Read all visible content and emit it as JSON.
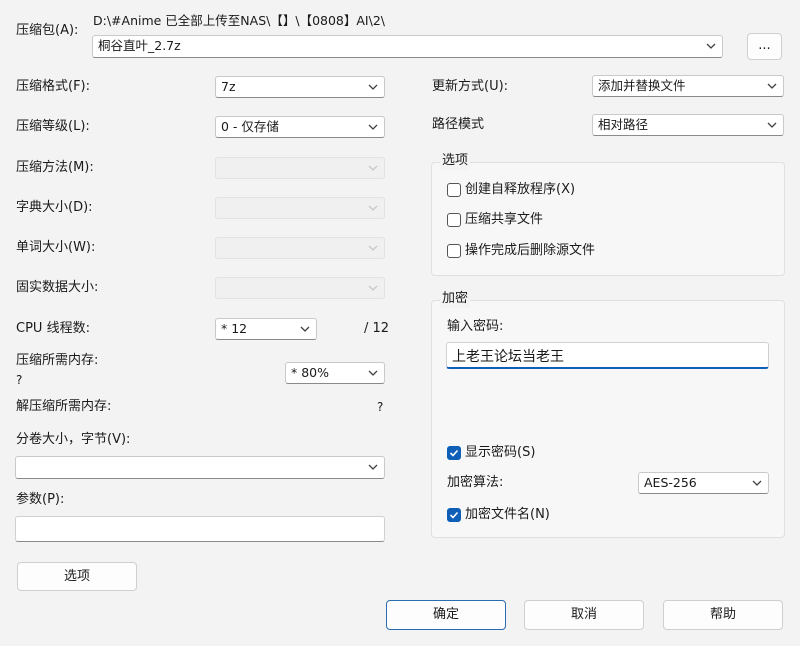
{
  "archive": {
    "label": "压缩包(A):",
    "path": "D:\\#Anime 已全部上传至NAS\\【】\\【0808】AI\\2\\",
    "filename": "桐谷直叶_2.7z",
    "browse_label": "..."
  },
  "left": {
    "format_label": "压缩格式(F):",
    "format_value": "7z",
    "level_label": "压缩等级(L):",
    "level_value": "0 - 仅存储",
    "method_label": "压缩方法(M):",
    "dict_label": "字典大小(D):",
    "word_label": "单词大小(W):",
    "solid_label": "固实数据大小:",
    "cpu_label": "CPU 线程数:",
    "cpu_value": "* 12",
    "cpu_total": "/ 12",
    "mem_label": "压缩所需内存:",
    "mem_value": "?",
    "mem_combo": "* 80%",
    "decomp_label": "解压缩所需内存:",
    "decomp_value": "?",
    "split_label": "分卷大小，字节(V):",
    "split_value": "",
    "params_label": "参数(P):",
    "params_value": "",
    "options_button": "选项"
  },
  "right": {
    "update_label": "更新方式(U):",
    "update_value": "添加并替换文件",
    "pathmode_label": "路径模式",
    "pathmode_value": "相对路径",
    "options_group": "选项",
    "opt_sfx": "创建自释放程序(X)",
    "opt_shared": "压缩共享文件",
    "opt_delete": "操作完成后删除源文件",
    "encrypt_group": "加密",
    "password_label": "输入密码:",
    "password_value": "上老王论坛当老王",
    "show_password": "显示密码(S)",
    "method_label": "加密算法:",
    "method_value": "AES-256",
    "encrypt_names": "加密文件名(N)"
  },
  "buttons": {
    "ok": "确定",
    "cancel": "取消",
    "help": "帮助"
  },
  "colors": {
    "accent": "#0f5fb8"
  }
}
